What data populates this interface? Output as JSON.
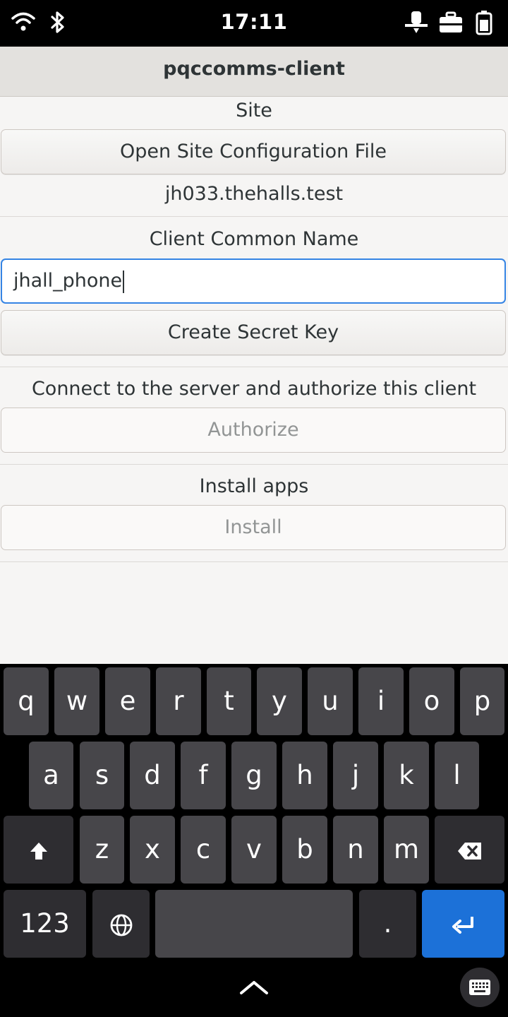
{
  "status_bar": {
    "time": "17:11",
    "left_icons": [
      "wifi-icon",
      "bluetooth-icon"
    ],
    "right_icons": [
      "location-icon",
      "vpn-icon",
      "battery-icon"
    ]
  },
  "header": {
    "title": "pqccomms-client"
  },
  "site": {
    "section_label": "Site",
    "open_button": "Open Site Configuration File",
    "site_value": "jh033.thehalls.test"
  },
  "client": {
    "section_label": "Client Common Name",
    "input_value": "jhall_phone",
    "create_button": "Create Secret Key"
  },
  "authorize": {
    "section_label": "Connect to the server and authorize this client",
    "button": "Authorize",
    "enabled": false
  },
  "install": {
    "section_label": "Install apps",
    "button": "Install",
    "enabled": false
  },
  "keyboard": {
    "row1": [
      "q",
      "w",
      "e",
      "r",
      "t",
      "y",
      "u",
      "i",
      "o",
      "p"
    ],
    "row2": [
      "a",
      "s",
      "d",
      "f",
      "g",
      "h",
      "j",
      "k",
      "l"
    ],
    "row3": [
      "z",
      "x",
      "c",
      "v",
      "b",
      "n",
      "m"
    ],
    "numbers_key": "123",
    "period_key": ".",
    "icons": [
      "shift-icon",
      "backspace-icon",
      "globe-icon",
      "enter-icon",
      "chevron-up-icon",
      "keyboard-icon"
    ],
    "colors": {
      "key": "#47464a",
      "special_key": "#2e2d31",
      "enter": "#1c71d8"
    }
  },
  "colors": {
    "accent": "#3584e4",
    "header_bg": "#e3e1de",
    "content_bg": "#f6f5f4",
    "text": "#2e3436"
  }
}
